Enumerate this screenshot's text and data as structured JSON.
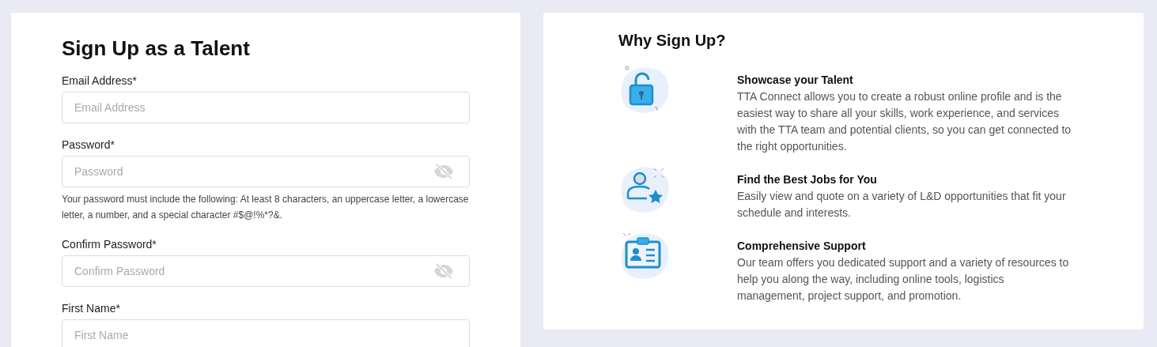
{
  "signup_form": {
    "title": "Sign Up as a Talent",
    "fields": [
      {
        "kind": "text",
        "label": "Email Address*",
        "placeholder": "Email Address"
      },
      {
        "kind": "password",
        "label": "Password*",
        "placeholder": "Password",
        "hint": "Your password must include the following: At least 8 characters, an uppercase letter, a lowercase letter, a number, and a special character #$@!%*?&."
      },
      {
        "kind": "password",
        "label": "Confirm Password*",
        "placeholder": "Confirm Password"
      },
      {
        "kind": "text",
        "label": "First Name*",
        "placeholder": "First Name"
      }
    ]
  },
  "why_sign_up": {
    "title": "Why Sign Up?",
    "benefits": [
      {
        "kind": "lock",
        "title": "Showcase your Talent",
        "text": "TTA Connect allows you to create a robust online profile and is the easiest way to share all your skills, work experience, and services with the TTA team and potential clients, so you can get connected to the right opportunities."
      },
      {
        "kind": "person-star",
        "title": "Find the Best Jobs for You",
        "text": "Easily view and quote on a variety of L&D opportunities that fit your schedule and interests."
      },
      {
        "kind": "id-card",
        "title": "Comprehensive Support",
        "text": "Our team offers you dedicated support and a variety of resources to help you along the way, including online tools, logistics management, project support, and promotion."
      }
    ]
  }
}
